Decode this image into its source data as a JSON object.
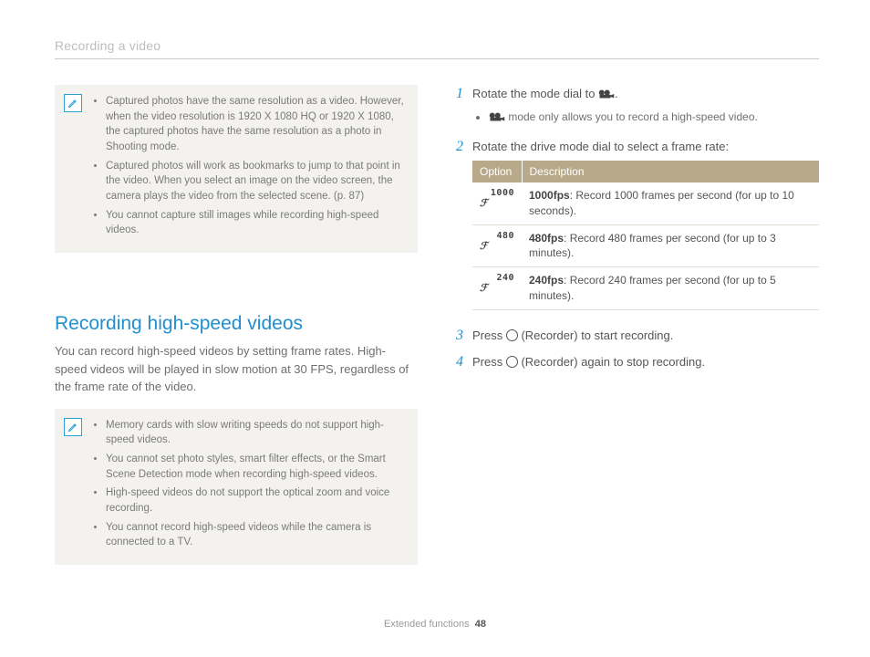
{
  "header": {
    "breadcrumb": "Recording a video"
  },
  "note1": {
    "items": [
      "Captured photos have the same resolution as a video. However, when the video resolution is 1920 X 1080 HQ or 1920 X 1080, the captured photos have the same resolution as a photo in Shooting mode.",
      "Captured photos will work as bookmarks to jump to that point in the video. When you select an image on the video screen, the camera plays the video from the selected scene. (p. 87)",
      "You cannot capture still images while recording high-speed videos."
    ]
  },
  "section": {
    "title": "Recording high-speed videos",
    "intro": "You can record high-speed videos by setting frame rates. High-speed videos will be played in slow motion at 30 FPS, regardless of the frame rate of the video."
  },
  "note2": {
    "items": [
      "Memory cards with slow writing speeds do not support high-speed videos.",
      "You cannot set photo styles, smart filter effects, or the Smart Scene Detection mode when recording high-speed videos.",
      "High-speed videos do not support the optical zoom and voice recording.",
      "You cannot record high-speed videos while the camera is connected to a TV."
    ]
  },
  "steps": {
    "s1": {
      "num": "1",
      "text_pre": "Rotate the mode dial to ",
      "text_post": ".",
      "bullet_post": " mode only allows you to record a high-speed video."
    },
    "s2": {
      "num": "2",
      "text": "Rotate the drive mode dial to select a frame rate:"
    },
    "s3": {
      "num": "3",
      "text_pre": "Press ",
      "text_post": " (Recorder) to start recording."
    },
    "s4": {
      "num": "4",
      "text_pre": "Press ",
      "text_post": " (Recorder) again to stop recording."
    }
  },
  "table": {
    "headers": {
      "option": "Option",
      "description": "Description"
    },
    "rows": [
      {
        "rate": "1000",
        "bold": "1000fps",
        "rest": ": Record 1000 frames per second (for up to 10 seconds)."
      },
      {
        "rate": "480",
        "bold": "480fps",
        "rest": ": Record 480 frames per second (for up to 3 minutes)."
      },
      {
        "rate": "240",
        "bold": "240fps",
        "rest": ": Record 240 frames per second (for up to 5 minutes)."
      }
    ]
  },
  "footer": {
    "section": "Extended functions",
    "page": "48"
  },
  "icons": {
    "note": "✎",
    "video_mode": "video-camera-icon"
  }
}
